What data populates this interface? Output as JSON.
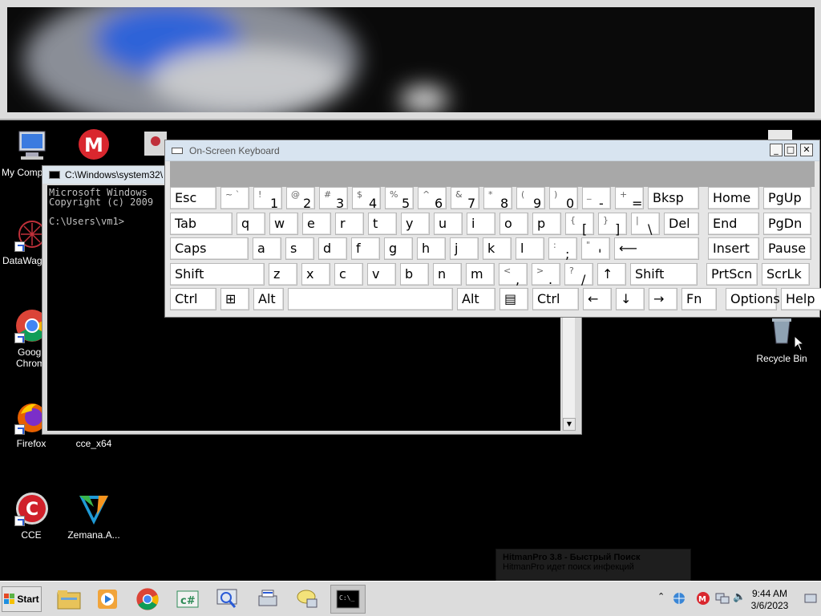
{
  "desktop": {
    "icons": [
      {
        "label": "My Comp",
        "icon": "computer-icon"
      },
      {
        "label": "DataWag",
        "icon": "datawag-icon"
      },
      {
        "label": "Googl",
        "label2": "Chrom",
        "icon": "chrome-icon"
      },
      {
        "label": "Firefox",
        "icon": "firefox-icon"
      },
      {
        "label": "CCE",
        "icon": "cce-icon"
      },
      {
        "label": "cce_x64",
        "icon": "cce-x64-icon"
      },
      {
        "label": "Zemana.A...",
        "icon": "zemana-icon"
      },
      {
        "label": "Recycle Bin",
        "icon": "recycle-bin-icon"
      }
    ]
  },
  "cmd": {
    "title": "C:\\Windows\\system32\\",
    "lines": [
      "Microsoft Windows",
      "Copyright (c) 2009",
      "",
      "C:\\Users\\vm1>"
    ]
  },
  "osk": {
    "title": "On-Screen Keyboard",
    "rows": [
      [
        {
          "main": "Esc",
          "w": 60,
          "gap": 0
        },
        {
          "sym": "~ `",
          "w": 38
        },
        {
          "sym": "!",
          "low": "1",
          "w": 38
        },
        {
          "sym": "@",
          "low": "2",
          "w": 38
        },
        {
          "sym": "#",
          "low": "3",
          "w": 38
        },
        {
          "sym": "$",
          "low": "4",
          "w": 38
        },
        {
          "sym": "%",
          "low": "5",
          "w": 38
        },
        {
          "sym": "^",
          "low": "6",
          "w": 38
        },
        {
          "sym": "&",
          "low": "7",
          "w": 38
        },
        {
          "sym": "*",
          "low": "8",
          "w": 38
        },
        {
          "sym": "(",
          "low": "9",
          "w": 38
        },
        {
          "sym": ")",
          "low": "0",
          "w": 38
        },
        {
          "sym": "_",
          "low": "-",
          "w": 38
        },
        {
          "sym": "+",
          "low": "=",
          "w": 38
        },
        {
          "main": "Bksp",
          "w": 66
        },
        {
          "main": "Home",
          "w": 66,
          "gap": 6
        },
        {
          "main": "PgUp",
          "w": 62
        }
      ],
      [
        {
          "main": "Tab",
          "w": 80
        },
        {
          "main": "q",
          "w": 38
        },
        {
          "main": "w",
          "w": 38
        },
        {
          "main": "e",
          "w": 38
        },
        {
          "main": "r",
          "w": 38
        },
        {
          "main": "t",
          "w": 38
        },
        {
          "main": "y",
          "w": 38
        },
        {
          "main": "u",
          "w": 38
        },
        {
          "main": "i",
          "w": 38
        },
        {
          "main": "o",
          "w": 38
        },
        {
          "main": "p",
          "w": 38
        },
        {
          "sym": "{",
          "low": "[",
          "w": 38
        },
        {
          "sym": "}",
          "low": "]",
          "w": 38
        },
        {
          "sym": "|",
          "low": "\\",
          "w": 38
        },
        {
          "main": "Del",
          "w": 46
        },
        {
          "main": "End",
          "w": 66,
          "gap": 6
        },
        {
          "main": "PgDn",
          "w": 62
        }
      ],
      [
        {
          "main": "Caps",
          "w": 100
        },
        {
          "main": "a",
          "w": 38
        },
        {
          "main": "s",
          "w": 38
        },
        {
          "main": "d",
          "w": 38
        },
        {
          "main": "f",
          "w": 38
        },
        {
          "main": "g",
          "w": 38
        },
        {
          "main": "h",
          "w": 38
        },
        {
          "main": "j",
          "w": 38
        },
        {
          "main": "k",
          "w": 38
        },
        {
          "main": "l",
          "w": 38
        },
        {
          "sym": ":",
          "low": ";",
          "w": 38
        },
        {
          "sym": "\"",
          "low": "'",
          "w": 38
        },
        {
          "main": "⟵",
          "w": 108
        },
        {
          "main": "Insert",
          "w": 66,
          "gap": 6
        },
        {
          "main": "Pause",
          "w": 62
        }
      ],
      [
        {
          "main": "Shift",
          "w": 120
        },
        {
          "main": "z",
          "w": 38
        },
        {
          "main": "x",
          "w": 38
        },
        {
          "main": "c",
          "w": 38
        },
        {
          "main": "v",
          "w": 38
        },
        {
          "main": "b",
          "w": 38
        },
        {
          "main": "n",
          "w": 38
        },
        {
          "main": "m",
          "w": 38
        },
        {
          "sym": "<",
          "low": ",",
          "w": 38
        },
        {
          "sym": ">",
          "low": ".",
          "w": 38
        },
        {
          "sym": "?",
          "low": "/",
          "w": 38
        },
        {
          "main": "↑",
          "w": 38
        },
        {
          "main": "Shift",
          "w": 86
        },
        {
          "main": "PrtScn",
          "w": 66,
          "gap": 6
        },
        {
          "main": "ScrLk",
          "w": 62
        }
      ],
      [
        {
          "main": "Ctrl",
          "w": 60
        },
        {
          "main": "⊞",
          "w": 38
        },
        {
          "main": "Alt",
          "w": 40
        },
        {
          "main": "",
          "w": 208
        },
        {
          "main": "Alt",
          "w": 50
        },
        {
          "main": "▤",
          "w": 38
        },
        {
          "main": "Ctrl",
          "w": 60
        },
        {
          "main": "←",
          "w": 38
        },
        {
          "main": "↓",
          "w": 38
        },
        {
          "main": "→",
          "w": 38
        },
        {
          "main": "Fn",
          "w": 46
        },
        {
          "main": "Options",
          "w": 66,
          "gap": 6
        },
        {
          "main": "Help",
          "w": 62
        }
      ]
    ]
  },
  "taskbar": {
    "start_label": "Start",
    "apps": [
      "explorer-icon",
      "media-player-icon",
      "chrome-icon",
      "csharp-icon",
      "search-icon",
      "printer-icon",
      "chat-icon",
      "cmd-icon"
    ],
    "tray": {
      "time": "9:44 AM",
      "date": "3/6/2023"
    }
  },
  "toast": {
    "title": "HitmanPro 3.8 - Быстрый Поиск",
    "body": "HitmanPro идет поиск инфекций"
  }
}
